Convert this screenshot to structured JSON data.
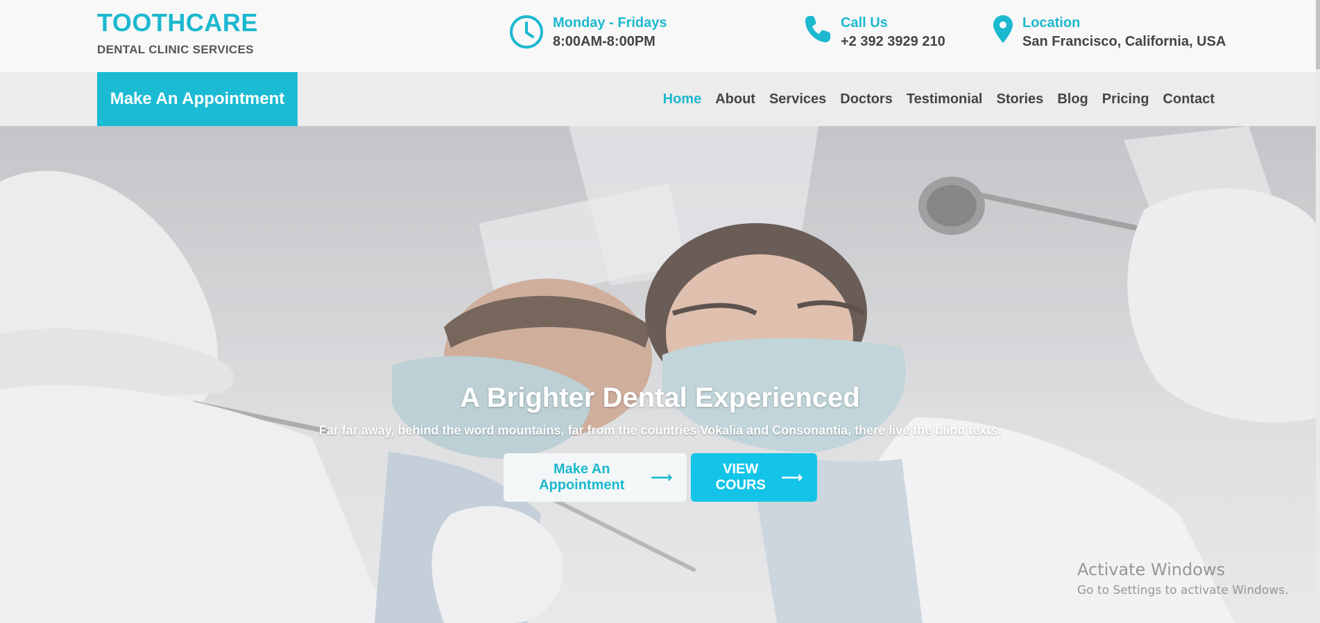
{
  "brand": {
    "title": "TOOTHCARE",
    "subtitle": "DENTAL CLINIC SERVICES"
  },
  "info": {
    "hours": {
      "title": "Monday - Fridays",
      "text": "8:00AM-8:00PM",
      "icon": "clock-icon"
    },
    "call": {
      "title": "Call Us",
      "text": "+2 392 3929 210",
      "icon": "phone-icon"
    },
    "location": {
      "title": "Location",
      "text": "San Francisco, California, USA",
      "icon": "map-pin-icon"
    }
  },
  "navbar": {
    "appointment_label": "Make An Appointment",
    "items": [
      {
        "label": "Home",
        "active": true
      },
      {
        "label": "About"
      },
      {
        "label": "Services"
      },
      {
        "label": "Doctors"
      },
      {
        "label": "Testimonial"
      },
      {
        "label": "Stories"
      },
      {
        "label": "Blog"
      },
      {
        "label": "Pricing"
      },
      {
        "label": "Contact"
      }
    ]
  },
  "hero": {
    "title": "A Brighter Dental Experienced",
    "subtitle": "Far far away, behind the word mountains, far from the countries Vokalia and Consonantia, there live the blind texts.",
    "primary_button": "Make An Appointment",
    "secondary_button": "VIEW COURS",
    "arrow": "⟶"
  },
  "watermark": {
    "title": "Activate Windows",
    "subtitle": "Go to Settings to activate Windows."
  },
  "colors": {
    "accent": "#1bb8cf",
    "button_blue": "#13c4e8",
    "text_dark": "#444444"
  }
}
